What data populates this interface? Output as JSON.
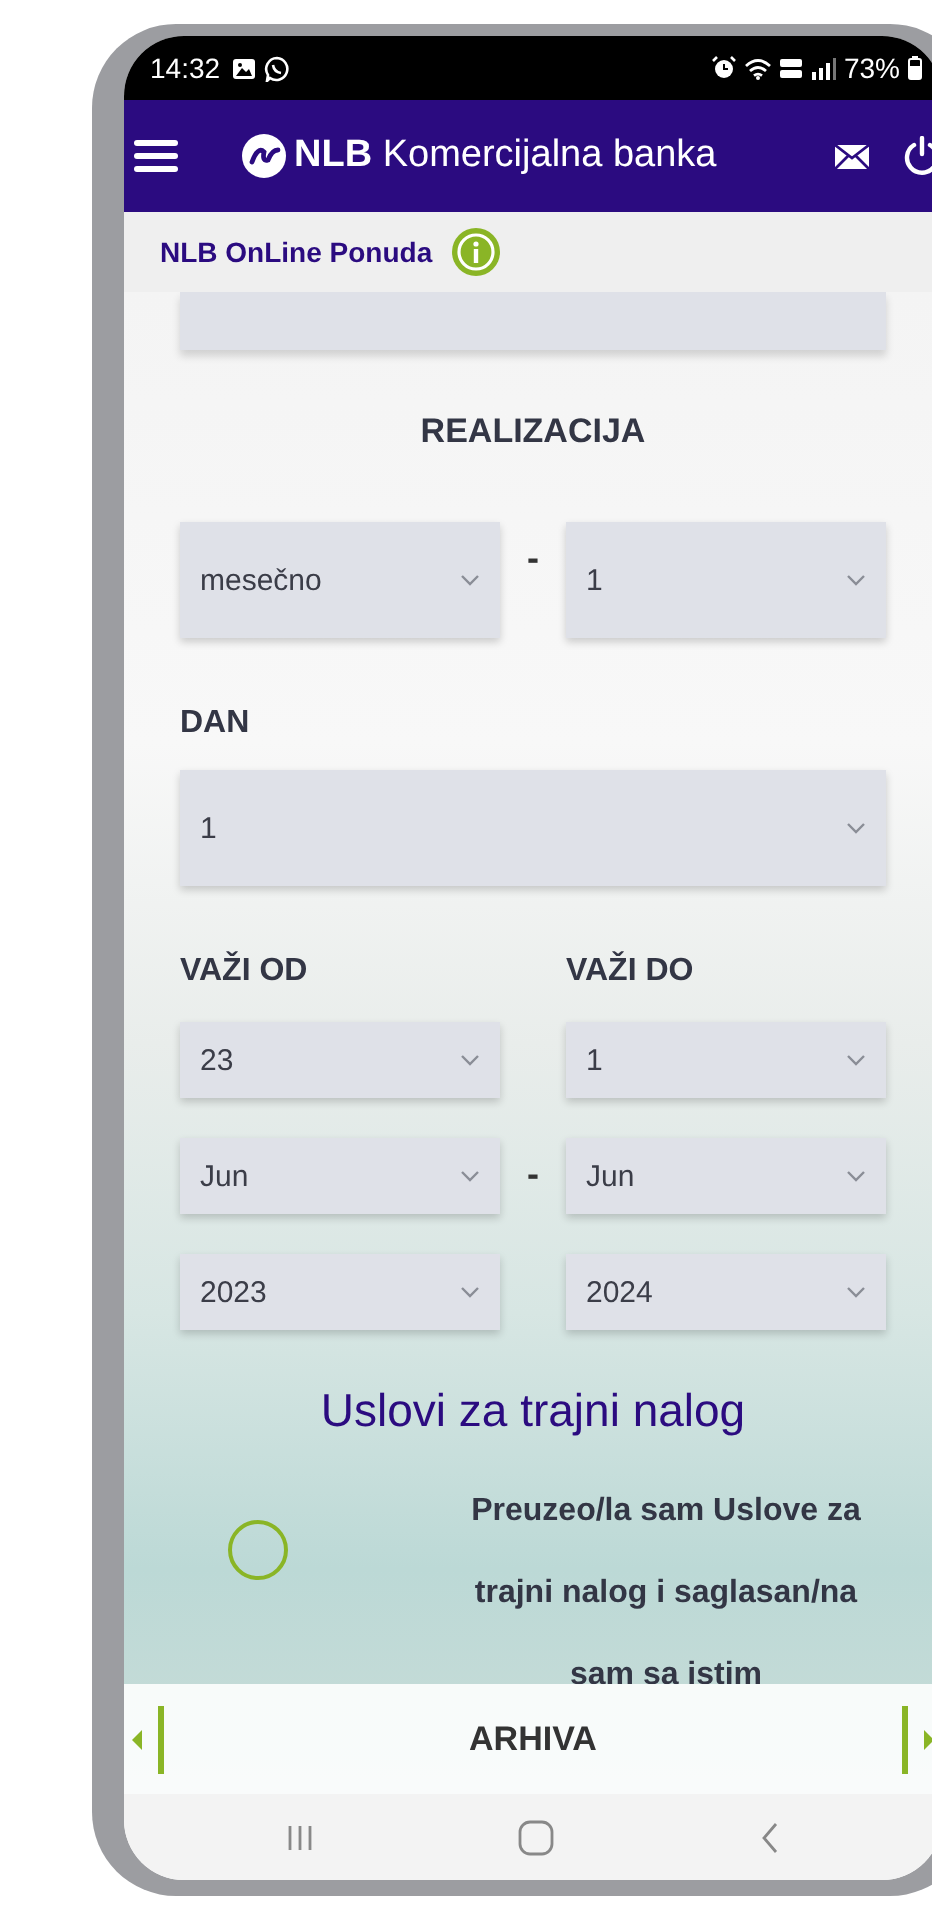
{
  "status_bar": {
    "time": "14:32",
    "battery": "73%"
  },
  "header": {
    "brand_short": "NLB",
    "brand_name": "Komercijalna banka"
  },
  "subheader": {
    "title": "NLB OnLine Ponuda"
  },
  "realizacija": {
    "title": "REALIZACIJA",
    "frequency": "mesečno",
    "separator": "-",
    "interval": "1"
  },
  "dan": {
    "label": "DAN",
    "value": "1"
  },
  "validity": {
    "from_label": "VAŽI OD",
    "to_label": "VAŽI DO",
    "rows": [
      {
        "from": "23",
        "separator": "",
        "to": "1"
      },
      {
        "from": "Jun",
        "separator": "-",
        "to": "Jun"
      },
      {
        "from": "2023",
        "separator": "",
        "to": "2024"
      }
    ]
  },
  "terms": {
    "title": "Uslovi za trajni nalog",
    "consent": {
      "checked": false,
      "text": "Preuzeo/la sam Uslove za trajni nalog i saglasan/na sam sa istim"
    }
  },
  "bottom_bar": {
    "label": "ARHIVA"
  }
}
